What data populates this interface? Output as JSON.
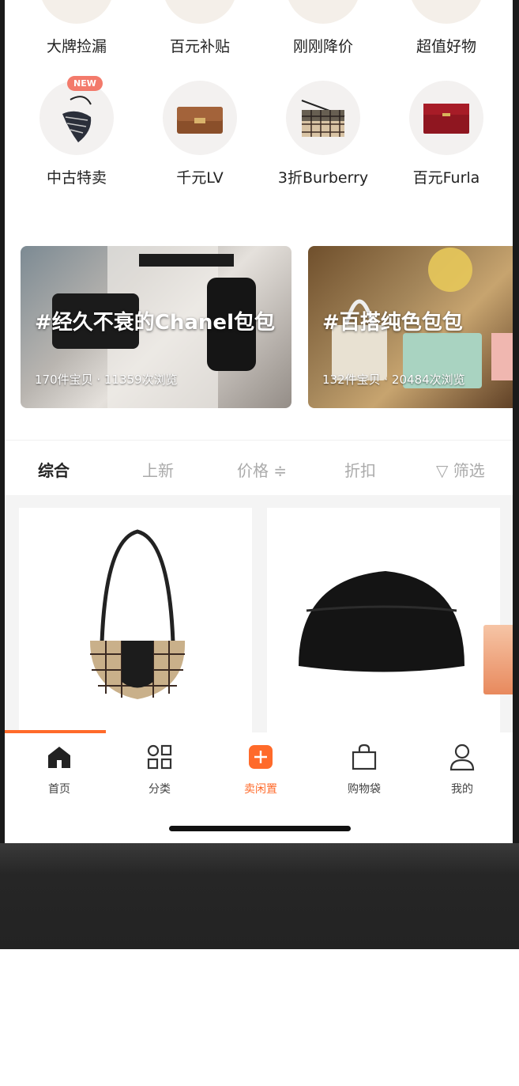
{
  "top_categories": [
    {
      "label": "大牌捡漏",
      "icon": "bag-icon"
    },
    {
      "label": "百元补贴",
      "icon": "bag-icon"
    },
    {
      "label": "刚刚降价",
      "icon": "bag-icon"
    },
    {
      "label": "超值好物",
      "icon": "bag-icon"
    }
  ],
  "categories": [
    {
      "label": "中古特卖",
      "icon": "saddle-bag-icon",
      "badge": "NEW"
    },
    {
      "label": "千元LV",
      "icon": "brown-bag-icon"
    },
    {
      "label": "3折Burberry",
      "icon": "plaid-bag-icon"
    },
    {
      "label": "百元Furla",
      "icon": "red-bag-icon"
    }
  ],
  "banners": [
    {
      "title": "#经久不衰的Chanel包包",
      "meta": "170件宝贝 · 11359次浏览"
    },
    {
      "title": "#百搭纯色包包",
      "meta": "132件宝贝 · 20484次浏览"
    }
  ],
  "sort": {
    "items": [
      "综合",
      "上新",
      "价格 ≑",
      "折扣",
      "▽ 筛选"
    ],
    "active": "综合"
  },
  "products": [
    {
      "image": "burberry-plaid-shoulder-bag"
    },
    {
      "image": "black-dome-pouch-bag"
    }
  ],
  "tabs": [
    {
      "label": "首页",
      "icon": "home-icon"
    },
    {
      "label": "分类",
      "icon": "grid-icon"
    },
    {
      "label": "卖闲置",
      "icon": "plus-icon"
    },
    {
      "label": "购物袋",
      "icon": "shopping-bag-icon"
    },
    {
      "label": "我的",
      "icon": "user-icon"
    }
  ],
  "colors": {
    "accent": "#ff6a2a",
    "badge": "#f37a6b"
  }
}
